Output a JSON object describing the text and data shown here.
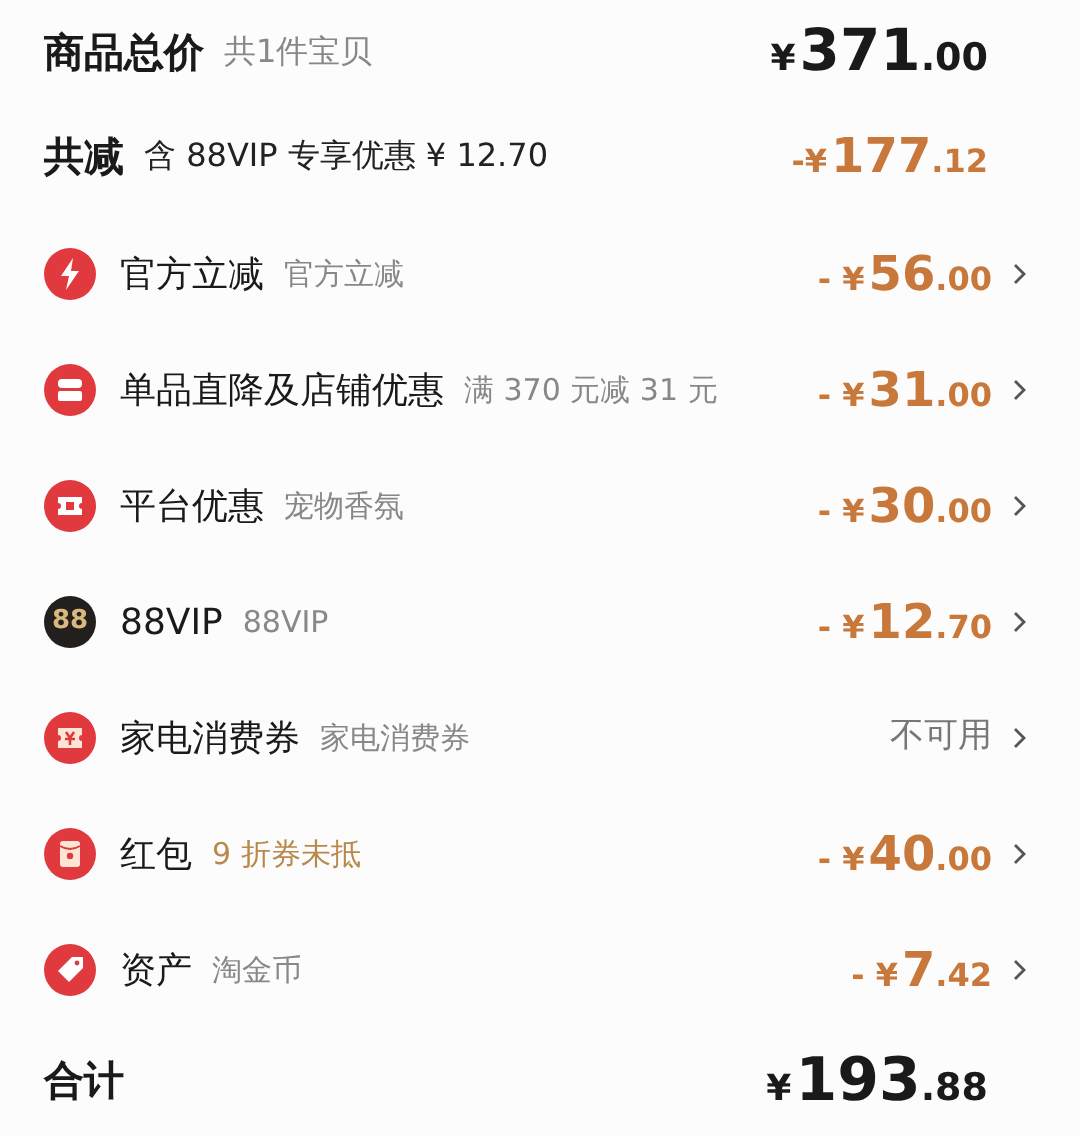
{
  "total_goods": {
    "label": "商品总价",
    "note": "共1件宝贝",
    "amount": {
      "prefix": "¥",
      "integer": "371",
      "fraction": ".00"
    }
  },
  "total_discount": {
    "label": "共减",
    "note": "含 88VIP 专享优惠 ¥ 12.70",
    "amount": {
      "prefix": "-¥",
      "integer": "177",
      "fraction": ".12"
    }
  },
  "discounts": [
    {
      "title": "官方立减",
      "subtitle": "官方立减",
      "subtitle_highlight": false,
      "value": {
        "kind": "amount",
        "prefix": "- ¥",
        "integer": "56",
        "fraction": ".00"
      }
    },
    {
      "title": "单品直降及店铺优惠",
      "subtitle": "满 370 元减 31 元",
      "subtitle_highlight": false,
      "value": {
        "kind": "amount",
        "prefix": "- ¥",
        "integer": "31",
        "fraction": ".00"
      }
    },
    {
      "title": "平台优惠",
      "subtitle": "宠物香氛",
      "subtitle_highlight": false,
      "value": {
        "kind": "amount",
        "prefix": "- ¥",
        "integer": "30",
        "fraction": ".00"
      }
    },
    {
      "icon_text": "88",
      "title": "88VIP",
      "subtitle": "88VIP",
      "subtitle_highlight": false,
      "value": {
        "kind": "amount",
        "prefix": "- ¥",
        "integer": "12",
        "fraction": ".70"
      }
    },
    {
      "title": "家电消费券",
      "subtitle": "家电消费券",
      "subtitle_highlight": false,
      "value": {
        "kind": "status",
        "text": "不可用"
      }
    },
    {
      "title": "红包",
      "subtitle": "9 折券未抵",
      "subtitle_highlight": true,
      "value": {
        "kind": "amount",
        "prefix": "- ¥",
        "integer": "40",
        "fraction": ".00"
      }
    },
    {
      "title": "资产",
      "subtitle": "淘金币",
      "subtitle_highlight": false,
      "value": {
        "kind": "amount",
        "prefix": "- ¥",
        "integer": "7",
        "fraction": ".42"
      }
    }
  ],
  "grand_total": {
    "label": "合计",
    "amount": {
      "prefix": "¥",
      "integer": "193",
      "fraction": ".88"
    }
  }
}
